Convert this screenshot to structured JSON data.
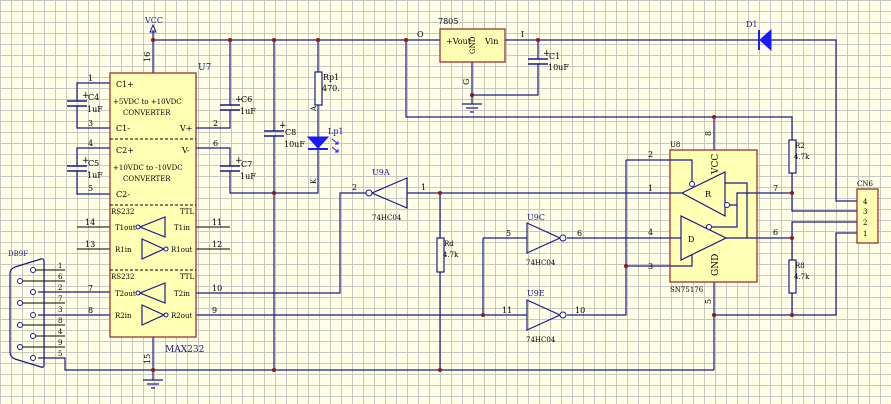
{
  "colors": {
    "wire": "#1a1a8c",
    "chip_fill": "#ffffb3",
    "chip_border": "#993333",
    "junction": "#8b1a1a",
    "background": "#ffffe8",
    "grid": "#c8c8c0"
  },
  "power": {
    "vcc": "VCC"
  },
  "u7": {
    "ref": "U7",
    "part": "MAX232",
    "c1p": "C1+",
    "c1m": "C1-",
    "c2p": "C2+",
    "c2m": "C2-",
    "vp": "V+",
    "vm": "V-",
    "conv1": "+5VDC to +10VDC",
    "conv2": "+10VDC to -10VDC",
    "converter": "CONVERTER",
    "rs232": "RS232",
    "ttl": "TTL",
    "t1out": "T1out",
    "t1in": "T1in",
    "r1in": "R1in",
    "r1out": "R1out",
    "t2out": "T2out",
    "t2in": "T2in",
    "r2in": "R2in",
    "r2out": "R2out",
    "pins": {
      "p16": "16",
      "p15": "15",
      "p1": "1",
      "p3": "3",
      "p4": "4",
      "p5": "5",
      "p2": "2",
      "p6": "6",
      "p14": "14",
      "p13": "13",
      "p7": "7",
      "p8": "8",
      "p11": "11",
      "p12": "12",
      "p10": "10",
      "p9": "9"
    }
  },
  "caps": {
    "c4": "C4",
    "c5": "C5",
    "c6": "C6",
    "c7": "C7",
    "c8": "C8",
    "c1": "C1",
    "v1u": "1uF",
    "v10u": "10uF",
    "v10nF": "10uF"
  },
  "led": {
    "rref": "Rp1",
    "rval": "470.",
    "ref": "Lp1",
    "a": "A",
    "k": "K"
  },
  "reg": {
    "ref": "7805",
    "vout": "+Vout",
    "gnd": "GND",
    "vin": "Vin",
    "o": "O",
    "g": "G",
    "i": "I"
  },
  "diode": {
    "ref": "D1"
  },
  "u9": {
    "a": "U9A",
    "c": "U9C",
    "e": "U9E",
    "part": "74HC04",
    "p2": "2",
    "p1": "1",
    "p5": "5",
    "p6": "6",
    "p11": "11",
    "p10": "10"
  },
  "res": {
    "rd": "Rd",
    "r2": "R2",
    "r8": "R8",
    "val": "4.7k"
  },
  "u8": {
    "ref": "U8",
    "part": "SN75176",
    "vcc": "VCC",
    "gnd": "GND",
    "r": "R",
    "d": "D",
    "p8": "8",
    "p2": "2",
    "p1": "1",
    "p4": "4",
    "p3": "3",
    "p7": "7",
    "p6": "6",
    "p5": "5"
  },
  "cn6": {
    "ref": "CN6",
    "pins": [
      "4",
      "3",
      "2",
      "1"
    ]
  },
  "db9": {
    "ref": "DB9F",
    "pins": [
      "1",
      "6",
      "2",
      "7",
      "3",
      "8",
      "4",
      "9",
      "5"
    ]
  }
}
